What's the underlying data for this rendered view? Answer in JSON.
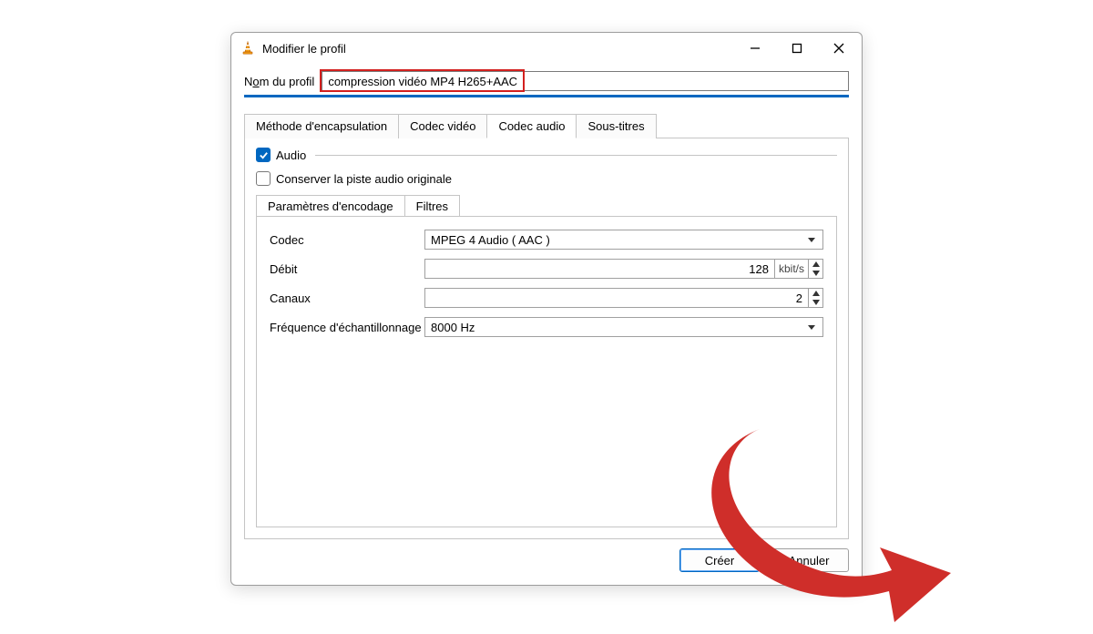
{
  "window": {
    "title": "Modifier le profil"
  },
  "profile": {
    "label_pre": "N",
    "label_und": "o",
    "label_post": "m du profil",
    "value": "compression vidéo MP4 H265+AAC"
  },
  "tabs_main": {
    "items": [
      {
        "label": "Méthode d'encapsulation"
      },
      {
        "label": "Codec vidéo"
      },
      {
        "label": "Codec audio"
      },
      {
        "label": "Sous-titres"
      }
    ],
    "active_index": 2
  },
  "audio_group": {
    "enabled_label": "Audio",
    "keep_original_label": "Conserver la piste audio originale"
  },
  "tabs_enc": {
    "items": [
      {
        "label": "Paramètres d'encodage"
      },
      {
        "label": "Filtres"
      }
    ],
    "active_index": 0
  },
  "form": {
    "codec_label": "Codec",
    "codec_value": "MPEG 4 Audio ( AAC )",
    "bitrate_label": "Débit",
    "bitrate_value": "128",
    "bitrate_unit": "kbit/s",
    "channels_label": "Canaux",
    "channels_value": "2",
    "samplerate_label": "Fréquence d'échantillonnage",
    "samplerate_value": "8000 Hz"
  },
  "buttons": {
    "create": "Créer",
    "cancel": "Annuler"
  }
}
